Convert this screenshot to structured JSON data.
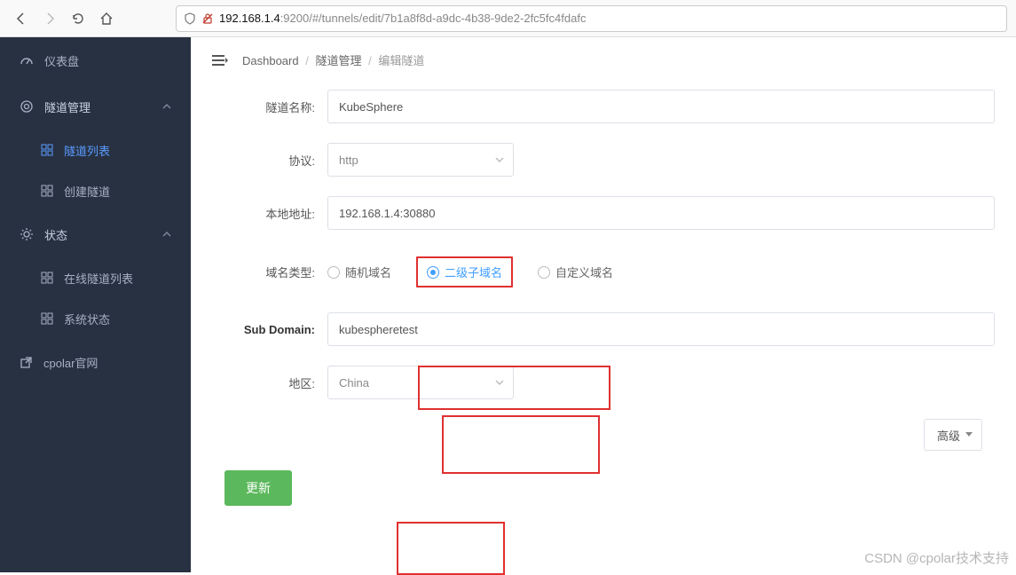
{
  "browser": {
    "url_host": "192.168.1.4",
    "url_path": ":9200/#/tunnels/edit/7b1a8f8d-a9dc-4b38-9de2-2fc5fc4fdafc"
  },
  "sidebar": {
    "dashboard": "仪表盘",
    "tunnel_mgmt": "隧道管理",
    "tunnel_list": "隧道列表",
    "create_tunnel": "创建隧道",
    "status": "状态",
    "online_tunnels": "在线隧道列表",
    "system_status": "系统状态",
    "cpolar_site": "cpolar官网"
  },
  "breadcrumbs": {
    "root": "Dashboard",
    "group": "隧道管理",
    "page": "编辑隧道"
  },
  "form": {
    "name_label": "隧道名称:",
    "name_value": "KubeSphere",
    "proto_label": "协议:",
    "proto_value": "http",
    "addr_label": "本地地址:",
    "addr_value": "192.168.1.4:30880",
    "domain_type_label": "域名类型:",
    "domain_opts": {
      "random": "随机域名",
      "sub": "二级子域名",
      "custom": "自定义域名"
    },
    "subdomain_label": "Sub Domain:",
    "subdomain_value": "kubespheretest",
    "region_label": "地区:",
    "region_value": "China",
    "advanced": "高级",
    "submit": "更新"
  },
  "watermark": "CSDN @cpolar技术支持"
}
